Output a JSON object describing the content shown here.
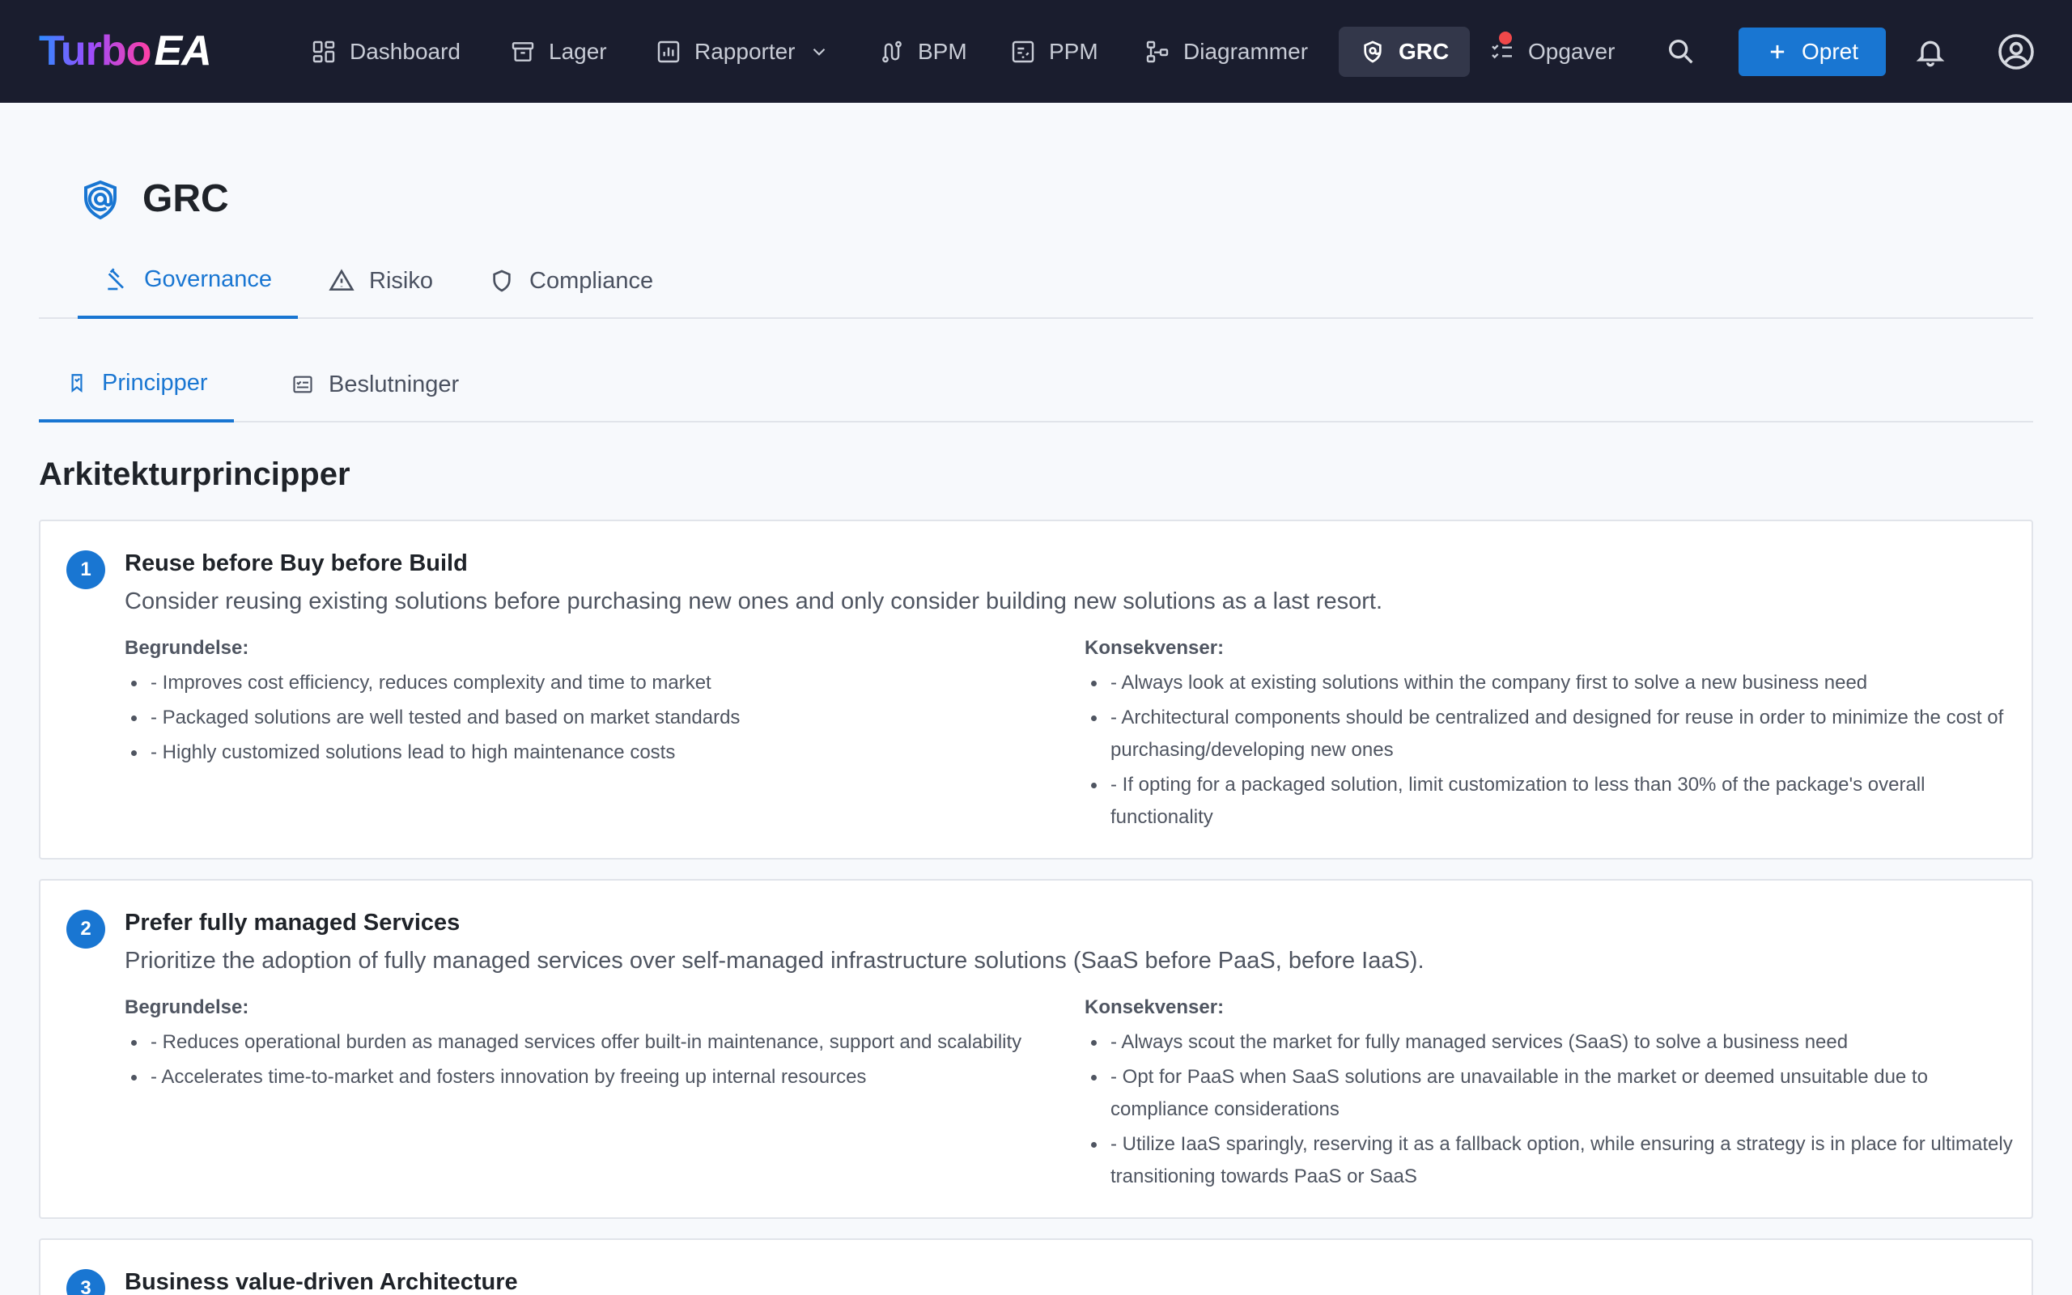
{
  "app": {
    "logo_left": "Turbo",
    "logo_right": "EA"
  },
  "nav": {
    "items": [
      {
        "label": "Dashboard",
        "icon": "dashboard-icon"
      },
      {
        "label": "Lager",
        "icon": "archive-icon"
      },
      {
        "label": "Rapporter",
        "icon": "report-icon"
      },
      {
        "label": "BPM",
        "icon": "route-icon"
      },
      {
        "label": "PPM",
        "icon": "project-icon"
      },
      {
        "label": "Diagrammer",
        "icon": "diagram-icon"
      },
      {
        "label": "GRC",
        "icon": "shield-icon"
      },
      {
        "label": "Opgaver",
        "icon": "tasks-icon"
      }
    ],
    "create_label": "Opret",
    "active_item": "GRC",
    "accent_color": "#1976d2",
    "notification_color": "#f0484a"
  },
  "page": {
    "title": "GRC",
    "tabs": [
      "Governance",
      "Risiko",
      "Compliance"
    ],
    "active_tab": "Governance",
    "subtabs": [
      "Principper",
      "Beslutninger"
    ],
    "active_subtab": "Principper",
    "section_title": "Arkitekturprincipper"
  },
  "principles": [
    {
      "number": "1",
      "title": "Reuse before Buy before Build",
      "description": "Consider reusing existing solutions before purchasing new ones and only consider building new solutions as a last resort.",
      "rationale_label": "Begrundelse:",
      "rationale": [
        "- Improves cost efficiency, reduces complexity and time to market",
        "- Packaged solutions are well tested and based on market standards",
        "- Highly customized solutions lead to high maintenance costs"
      ],
      "implications_label": "Konsekvenser:",
      "implications": [
        "- Always look at existing solutions within the company first to solve a new business need",
        "- Architectural components should be centralized and designed for reuse in order to minimize the cost of purchasing/developing new ones",
        "- If opting for a packaged solution, limit customization to less than 30% of the package's overall functionality"
      ]
    },
    {
      "number": "2",
      "title": "Prefer fully managed Services",
      "description": "Prioritize the adoption of fully managed services over self-managed infrastructure solutions (SaaS before PaaS, before IaaS).",
      "rationale_label": "Begrundelse:",
      "rationale": [
        "- Reduces operational burden as managed services offer built-in maintenance, support and scalability",
        "- Accelerates time-to-market and fosters innovation by freeing up internal resources"
      ],
      "implications_label": "Konsekvenser:",
      "implications": [
        "- Always scout the market for fully managed services (SaaS) to solve a business need",
        "- Opt for PaaS when SaaS solutions are unavailable in the market or deemed unsuitable due to compliance considerations",
        "- Utilize IaaS sparingly, reserving it as a fallback option, while ensuring a strategy is in place for ultimately transitioning towards PaaS or SaaS"
      ]
    },
    {
      "number": "3",
      "title": "Business value-driven Architecture"
    }
  ]
}
